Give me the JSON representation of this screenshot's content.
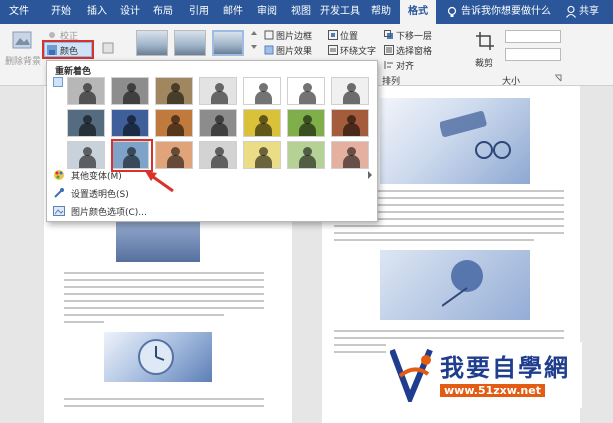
{
  "menubar": {
    "tabs": [
      {
        "label": "文件"
      },
      {
        "label": "开始"
      },
      {
        "label": "插入"
      },
      {
        "label": "设计"
      },
      {
        "label": "布局"
      },
      {
        "label": "引用"
      },
      {
        "label": "邮件"
      },
      {
        "label": "审阅"
      },
      {
        "label": "视图"
      },
      {
        "label": "开发工具"
      },
      {
        "label": "帮助"
      },
      {
        "label": "格式"
      }
    ],
    "active_tab": "格式",
    "search_placeholder": "告诉我你想要做什么",
    "share_label": "共享"
  },
  "ribbon": {
    "remove_bg": "删除背景",
    "correct": "校正",
    "color": "颜色",
    "border": "图片边框",
    "effect": "图片效果",
    "position": "位置",
    "wrap": "环绕文字",
    "down_one": "下移一层",
    "selection_pane": "选择窗格",
    "align": "对齐",
    "crop": "裁剪",
    "arrange_group": "排列",
    "size_group": "大小"
  },
  "dropdown": {
    "recolor_title": "重新着色",
    "more_variants": "其他变体(M)",
    "set_transparent": "设置透明色(S)",
    "color_options": "图片颜色选项(C)...",
    "swatch_rows": [
      [
        "#b7b7b7",
        "#8d8d8d",
        "#a08760",
        "#e3e3e3",
        "#ffffff",
        "#ffffff",
        "#f0f0f0"
      ],
      [
        "#556b7f",
        "#3f5f9a",
        "#c07a3e",
        "#8c8c8c",
        "#d9c13a",
        "#7fae4a",
        "#a45c3c"
      ],
      [
        "#c9d2db",
        "#7fa2c8",
        "#e1a47a",
        "#d3d3d3",
        "#ebdc86",
        "#b6d196",
        "#e4b0a0"
      ]
    ]
  },
  "colors": {
    "ribbon_blue": "#2b579a",
    "highlight_red": "#d9322c",
    "logo_blue": "#1f3d8f",
    "logo_orange": "#e35c12"
  },
  "watermark": {
    "title": "我要自學網",
    "url": "www.51zxw.net"
  }
}
